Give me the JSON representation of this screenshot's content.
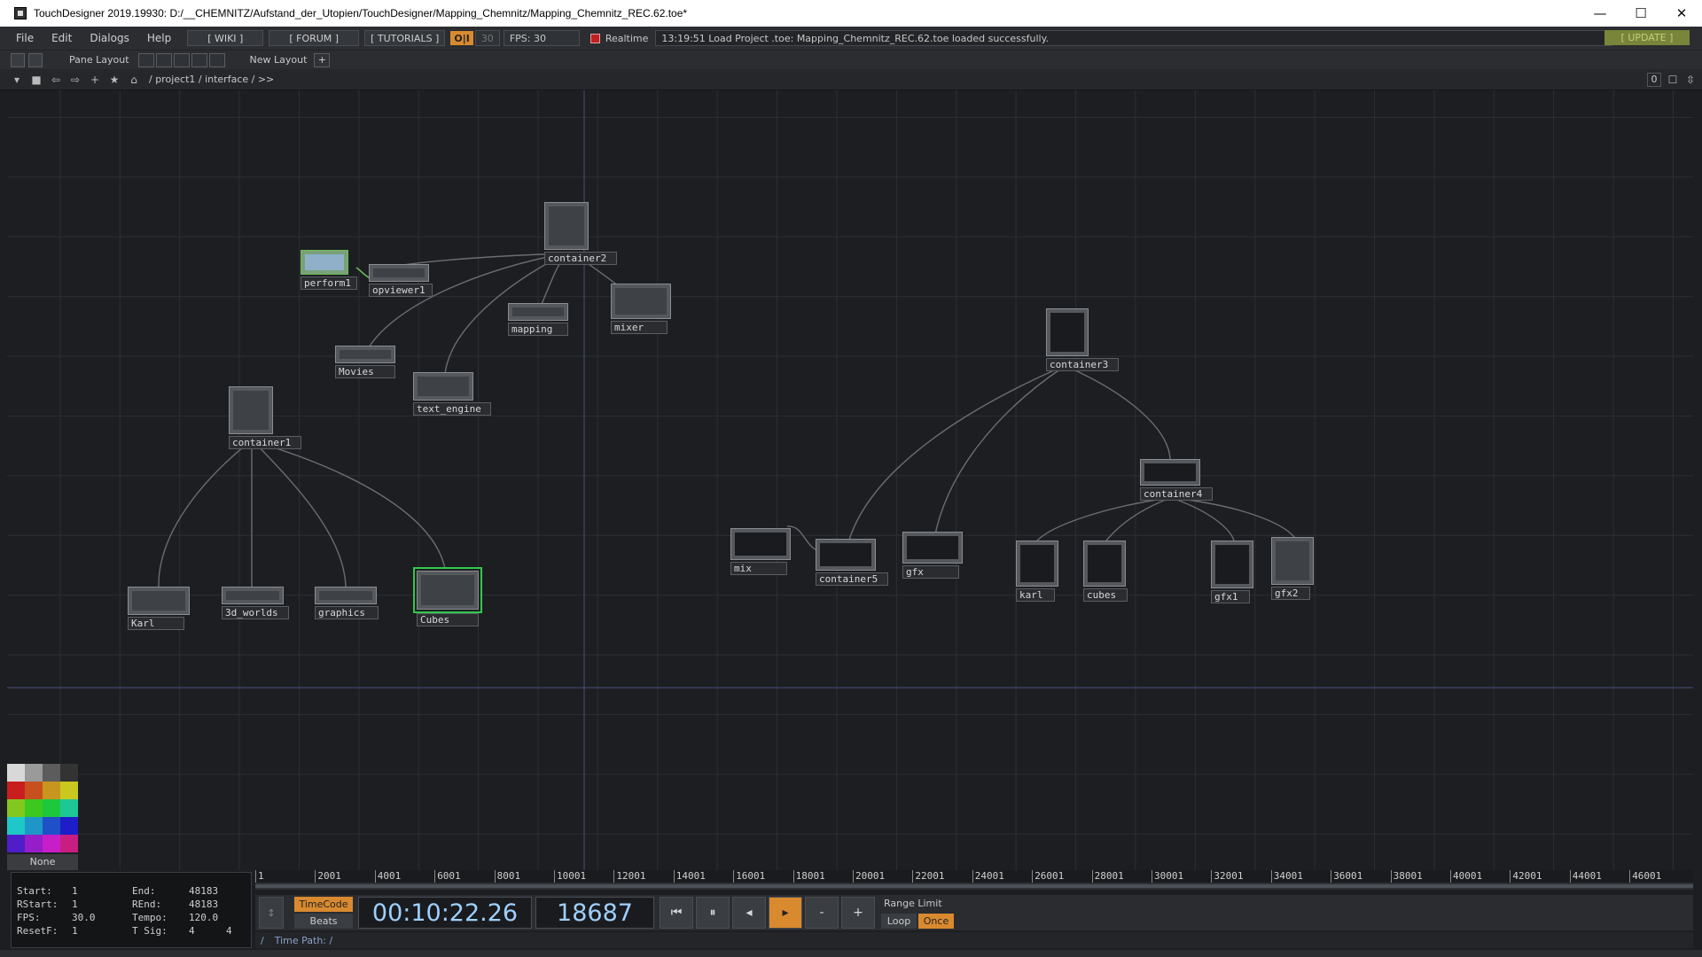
{
  "window": {
    "title": "TouchDesigner 2019.19930: D:/__CHEMNITZ/Aufstand_der_Utopien/TouchDesigner/Mapping_Chemnitz/Mapping_Chemnitz_REC.62.toe*",
    "minimize": "—",
    "maximize": "☐",
    "close": "✕"
  },
  "menu": {
    "items": [
      "File",
      "Edit",
      "Dialogs",
      "Help"
    ],
    "wiki": "[ WIKI ]",
    "forum": "[ FORUM ]",
    "tutorials": "[ TUTORIALS ]",
    "oi": "O|I",
    "fps_small": "30",
    "fps": "FPS: 30",
    "realtime": "Realtime",
    "status": "13:19:51 Load Project .toe: Mapping_Chemnitz_REC.62.toe loaded successfully.",
    "update": "[ UPDATE ]"
  },
  "panebar": {
    "pane_layout": "Pane Layout",
    "new_layout": "New Layout",
    "add": "+"
  },
  "pathbar": {
    "path": "/ project1 / interface / >>",
    "count": "0"
  },
  "nodes": [
    {
      "id": "container2",
      "label": "container2"
    },
    {
      "id": "perform1",
      "label": "perform1"
    },
    {
      "id": "opviewer1",
      "label": "opviewer1"
    },
    {
      "id": "mapping",
      "label": "mapping"
    },
    {
      "id": "mixer",
      "label": "mixer"
    },
    {
      "id": "movies",
      "label": "Movies"
    },
    {
      "id": "text_engine",
      "label": "text_engine"
    },
    {
      "id": "container1",
      "label": "container1"
    },
    {
      "id": "karl",
      "label": "Karl"
    },
    {
      "id": "worlds",
      "label": "3d_worlds"
    },
    {
      "id": "graphics",
      "label": "graphics"
    },
    {
      "id": "cubes_sel",
      "label": "Cubes"
    },
    {
      "id": "container3",
      "label": "container3"
    },
    {
      "id": "container4",
      "label": "container4"
    },
    {
      "id": "mix",
      "label": "mix"
    },
    {
      "id": "container5",
      "label": "container5"
    },
    {
      "id": "gfx",
      "label": "gfx"
    },
    {
      "id": "karl2",
      "label": "karl"
    },
    {
      "id": "cubes2",
      "label": "cubes"
    },
    {
      "id": "gfx1",
      "label": "gfx1"
    },
    {
      "id": "gfx2",
      "label": "gfx2"
    }
  ],
  "palette": {
    "none": "None",
    "colors": [
      "#d8d8d8",
      "#9a9a9a",
      "#5c5c5c",
      "#333333",
      "#c81e1e",
      "#c8501e",
      "#c8961e",
      "#c8c81e",
      "#82c81e",
      "#3cc81e",
      "#1ec83c",
      "#1ec896",
      "#1ec8c8",
      "#1e96c8",
      "#1e50c8",
      "#1e1ec8",
      "#501ec8",
      "#961ec8",
      "#c81ec8",
      "#c81e82"
    ]
  },
  "ruler": {
    "ticks": [
      "1",
      "2001",
      "4001",
      "6001",
      "8001",
      "10001",
      "12001",
      "14001",
      "16001",
      "18001",
      "20001",
      "22001",
      "24001",
      "26001",
      "28001",
      "30001",
      "32001",
      "34001",
      "36001",
      "38001",
      "40001",
      "42001",
      "44001",
      "46001"
    ]
  },
  "info": {
    "start_label": "Start:",
    "start": "1",
    "end_label": "End:",
    "end": "48183",
    "rstart_label": "RStart:",
    "rstart": "1",
    "rend_label": "REnd:",
    "rend": "48183",
    "fps_label": "FPS:",
    "fps": "30.0",
    "tempo_label": "Tempo:",
    "tempo": "120.0",
    "resetf_label": "ResetF:",
    "resetf": "1",
    "tsig_label": "T Sig:",
    "tsig_a": "4",
    "tsig_b": "4"
  },
  "transport": {
    "timecode": "TimeCode",
    "beats": "Beats",
    "time": "00:10:22.26",
    "frame": "18687",
    "rewind": "⏮",
    "pause": "⏸",
    "back": "◂",
    "play": "▸",
    "minus": "-",
    "plus": "+",
    "range_limit": "Range Limit",
    "loop": "Loop",
    "once": "Once",
    "time_path": "Time Path: /",
    "slash": "/"
  },
  "colors": {
    "accent_orange": "#d98a2f",
    "selected_green": "#33c84a",
    "update_green": "#78853a"
  }
}
